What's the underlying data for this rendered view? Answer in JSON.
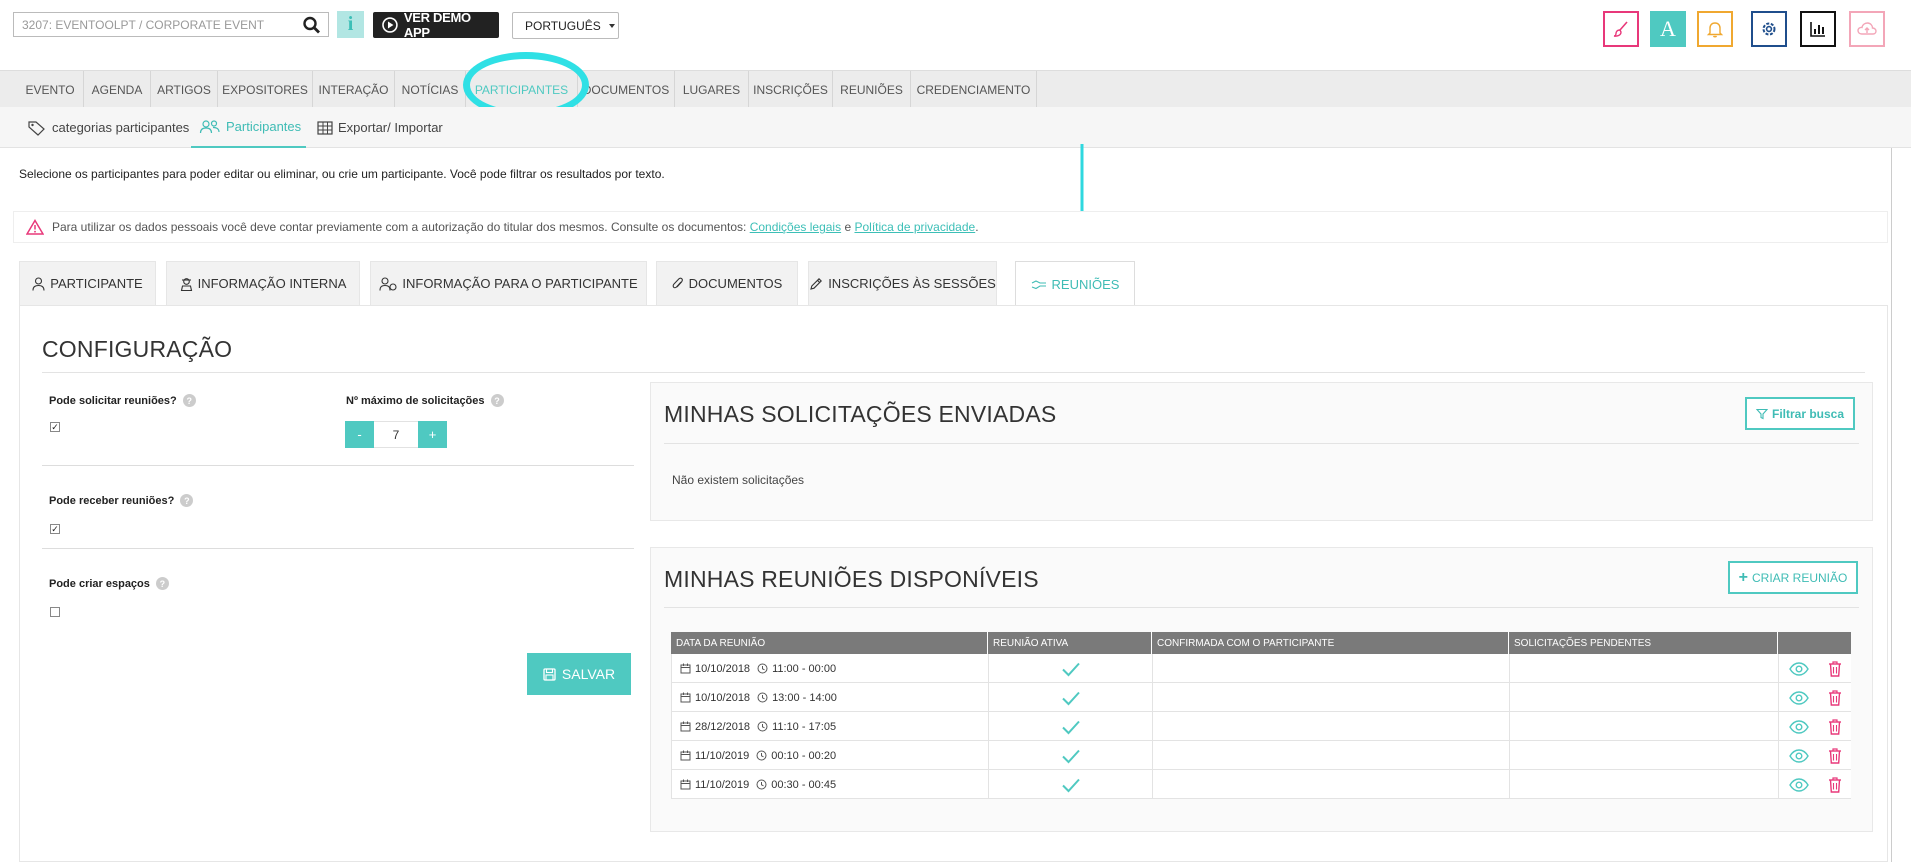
{
  "header": {
    "search_value": "3207: EVENTOOLPT / CORPORATE EVENT",
    "demo_label": "VER DEMO APP",
    "language": "PORTUGUÊS",
    "tools": [
      {
        "icon": "brush-icon",
        "color": "#e8387a"
      },
      {
        "icon": "font-icon",
        "color": "#4fc9c1"
      },
      {
        "icon": "bell-icon",
        "color": "#f0a830"
      },
      {
        "icon": "gear-icon",
        "color": "#1f4e8c"
      },
      {
        "icon": "chart-icon",
        "color": "#111111"
      },
      {
        "icon": "cloud-upload-icon",
        "color": "#f3a6b8"
      }
    ]
  },
  "main_nav": [
    "EVENTO",
    "AGENDA",
    "ARTIGOS",
    "EXPOSITORES",
    "INTERAÇÃO",
    "NOTÍCIAS",
    "PARTICIPANTES",
    "DOCUMENTOS",
    "LUGARES",
    "INSCRIÇÕES",
    "REUNIÕES",
    "CREDENCIAMENTO"
  ],
  "main_nav_active": "PARTICIPANTES",
  "sub_nav": [
    "categorias participantes",
    "Participantes",
    "Exportar/ Importar"
  ],
  "intro_text": "Selecione os participantes para poder editar ou eliminar, ou crie um participante. Você pode filtrar os resultados por texto.",
  "notice": {
    "text": "Para utilizar os dados pessoais você deve contar previamente com a autorização do titular dos mesmos. Consulte os documentos:",
    "link1": "Condições legais",
    "connector": "e",
    "link2": "Política de privacidade",
    "end": "."
  },
  "tabs": [
    "PARTICIPANTE",
    "INFORMAÇÃO INTERNA",
    "INFORMAÇÃO PARA O PARTICIPANTE",
    "DOCUMENTOS",
    "INSCRIÇÕES ÀS SESSÕES",
    "REUNIÕES"
  ],
  "active_tab": "REUNIÕES",
  "config": {
    "title": "CONFIGURAÇÃO",
    "can_request_label": "Pode solicitar reuniões?",
    "can_request": true,
    "max_requests_label": "Nº máximo de solicitações",
    "max_requests": "7",
    "minus": "-",
    "plus": "+",
    "can_receive_label": "Pode receber reuniões?",
    "can_receive": true,
    "can_create_label": "Pode criar espaços",
    "can_create": false,
    "save_label": "SALVAR"
  },
  "sent_requests": {
    "title": "MINHAS SOLICITAÇÕES ENVIADAS",
    "filter_label": "Filtrar busca",
    "empty_text": "Não existem solicitações"
  },
  "meetings": {
    "title": "MINHAS REUNIÕES DISPONÍVEIS",
    "create_label": "CRIAR REUNIÃO",
    "columns": [
      "DATA DA REUNIÃO",
      "REUNIÃO ATIVA",
      "CONFIRMADA COM O PARTICIPANTE",
      "SOLICITAÇÕES PENDENTES"
    ],
    "rows": [
      {
        "date": "10/10/2018",
        "time": "11:00 - 00:00",
        "active": true
      },
      {
        "date": "10/10/2018",
        "time": "13:00 - 14:00",
        "active": true
      },
      {
        "date": "28/12/2018",
        "time": "11:10 - 17:05",
        "active": true
      },
      {
        "date": "11/10/2019",
        "time": "00:10 - 00:20",
        "active": true
      },
      {
        "date": "11/10/2019",
        "time": "00:30 - 00:45",
        "active": true
      }
    ]
  },
  "colors": {
    "accent": "#4fc9c1",
    "danger": "#e8387a",
    "highlight": "#2fe0e5"
  }
}
